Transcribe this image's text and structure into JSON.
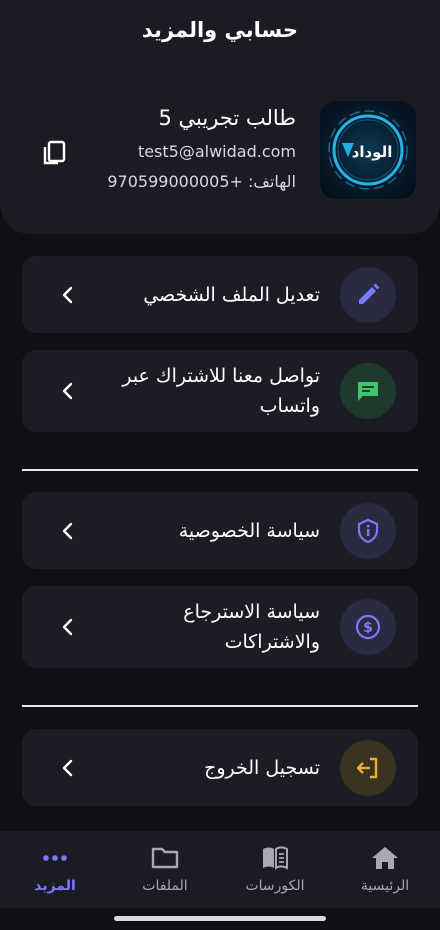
{
  "header": {
    "title": "حسابي والمزيد"
  },
  "profile": {
    "name": "طالب تجريبي 5",
    "email": "test5@alwidad.com",
    "phone": "الهاتف: +970599000005",
    "logo_text": "الوداد"
  },
  "menu": {
    "edit_profile": "تعديل الملف الشخصي",
    "whatsapp": "تواصل معنا للاشتراك عبر واتساب",
    "privacy": "سياسة الخصوصية",
    "refund": "سياسة الاسترجاع والاشتراكات",
    "logout": "تسجيل الخروج"
  },
  "tabs": [
    {
      "label": "الرئيسية",
      "icon": "home-icon"
    },
    {
      "label": "الكورسات",
      "icon": "book-icon"
    },
    {
      "label": "الملفات",
      "icon": "folder-icon"
    },
    {
      "label": "المزيد",
      "icon": "more-dots-icon"
    }
  ],
  "colors": {
    "background": "#0f0f14",
    "card": "#1c1c26",
    "accent_purple": "#7b7bff",
    "accent_green": "#3ec46d",
    "accent_yellow": "#e6b22e"
  }
}
